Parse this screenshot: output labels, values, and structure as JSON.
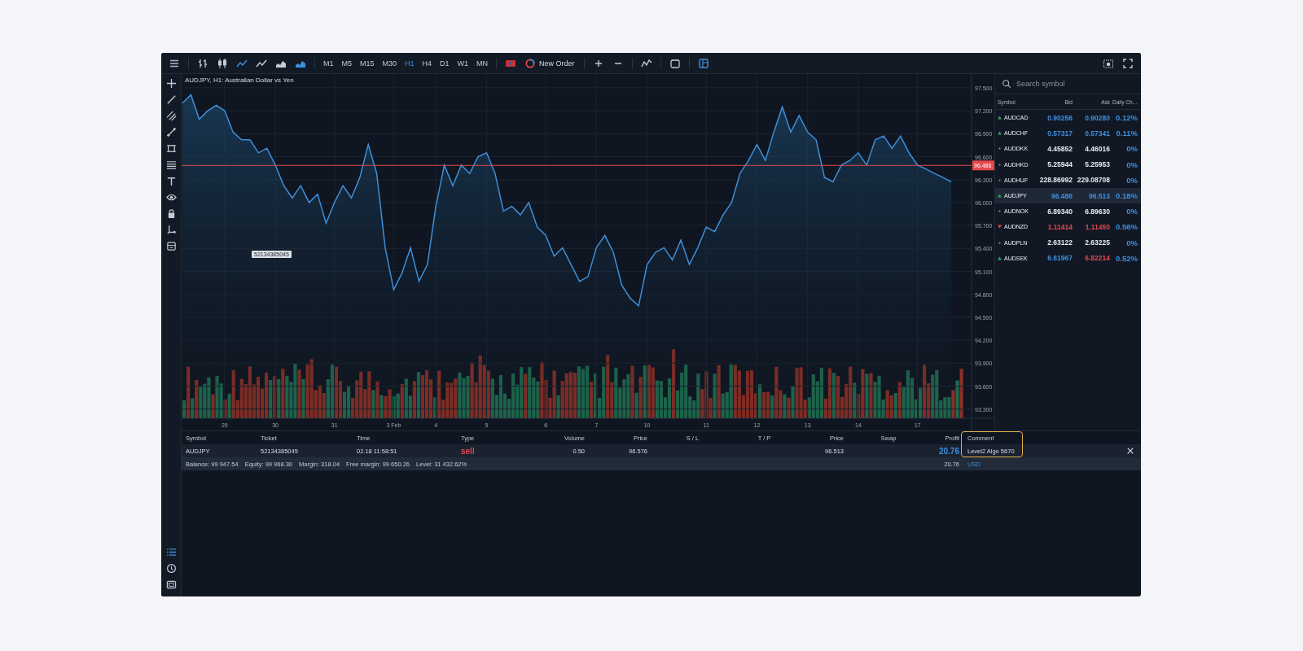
{
  "toolbar": {
    "chart_types": [
      {
        "kind": "bars",
        "selected": false
      },
      {
        "kind": "candles",
        "selected": false
      },
      {
        "kind": "line",
        "selected": true
      },
      {
        "kind": "line",
        "selected": false
      },
      {
        "kind": "area",
        "selected": false
      },
      {
        "kind": "area",
        "selected": true
      }
    ],
    "timeframes": [
      {
        "label": "M1",
        "selected": false
      },
      {
        "label": "M5",
        "selected": false
      },
      {
        "label": "M15",
        "selected": false
      },
      {
        "label": "M30",
        "selected": false
      },
      {
        "label": "H1",
        "selected": true
      },
      {
        "label": "H4",
        "selected": false
      },
      {
        "label": "D1",
        "selected": false
      },
      {
        "label": "W1",
        "selected": false
      },
      {
        "label": "MN",
        "selected": false
      }
    ],
    "new_order": "New Order",
    "layout_active": true
  },
  "chart": {
    "title": "AUDJPY, H1: Australian Dollar vs Yen",
    "order_tag": "52134385045",
    "chart_data": {
      "type": "area",
      "grid": true,
      "ylim": [
        93.18,
        97.68
      ],
      "categories": [
        null,
        null,
        null,
        null,
        null,
        "29",
        null,
        null,
        null,
        null,
        null,
        "30",
        null,
        null,
        null,
        null,
        null,
        null,
        "31",
        null,
        null,
        null,
        null,
        null,
        null,
        "3 Feb",
        null,
        null,
        null,
        null,
        "4",
        null,
        null,
        null,
        null,
        null,
        "5",
        null,
        null,
        null,
        null,
        null,
        null,
        "6",
        null,
        null,
        null,
        null,
        null,
        "7",
        null,
        null,
        null,
        null,
        null,
        "10",
        null,
        null,
        null,
        null,
        null,
        null,
        "11",
        null,
        null,
        null,
        null,
        null,
        "12",
        null,
        null,
        null,
        null,
        null,
        "13",
        null,
        null,
        null,
        null,
        null,
        "14",
        null,
        null,
        null,
        null,
        null,
        null,
        "17",
        null,
        null,
        null,
        null
      ],
      "yticks": [
        {
          "value": 97.5,
          "label": "97.500"
        },
        {
          "value": 97.2,
          "label": "97.200"
        },
        {
          "value": 96.9,
          "label": "96.900"
        },
        {
          "value": 96.6,
          "label": "96.600"
        },
        {
          "value": 96.3,
          "label": "96.300"
        },
        {
          "value": 96.0,
          "label": "96.000"
        },
        {
          "value": 95.7,
          "label": "95.700"
        },
        {
          "value": 95.4,
          "label": "95.400"
        },
        {
          "value": 95.1,
          "label": "95.100"
        },
        {
          "value": 94.8,
          "label": "94.800"
        },
        {
          "value": 94.5,
          "label": "94.500"
        },
        {
          "value": 94.2,
          "label": "94.200"
        },
        {
          "value": 93.9,
          "label": "93.900"
        },
        {
          "value": 93.6,
          "label": "93.600"
        },
        {
          "value": 93.3,
          "label": "93.300"
        }
      ],
      "series": [
        {
          "color": "#3e8ed8",
          "values": [
            97.3,
            97.41,
            97.09,
            97.2,
            97.27,
            97.2,
            96.92,
            96.82,
            96.82,
            96.65,
            96.71,
            96.49,
            96.22,
            96.06,
            96.22,
            96.0,
            96.11,
            95.73,
            96.0,
            96.22,
            96.06,
            96.33,
            96.76,
            96.38,
            95.41,
            94.86,
            95.08,
            95.41,
            94.97,
            95.19,
            95.95,
            96.49,
            96.22,
            96.49,
            96.38,
            96.6,
            96.65,
            96.38,
            95.89,
            95.95,
            95.84,
            96.0,
            95.68,
            95.57,
            95.3,
            95.41,
            95.19,
            94.97,
            95.03,
            95.41,
            95.57,
            95.35,
            94.92,
            94.75,
            94.65,
            95.19,
            95.35,
            95.41,
            95.25,
            95.51,
            95.19,
            95.41,
            95.68,
            95.62,
            95.84,
            96.0,
            96.38,
            96.55,
            96.76,
            96.55,
            96.92,
            97.25,
            96.92,
            97.14,
            96.92,
            96.82,
            96.33,
            96.27,
            96.49,
            96.55,
            96.65,
            96.49,
            96.82,
            96.87,
            96.71,
            96.87,
            96.65,
            96.49,
            96.44,
            96.38,
            96.33,
            96.27
          ]
        }
      ],
      "ref_lines": [
        {
          "axis": "y",
          "value": 96.486,
          "label": "96.486",
          "color": "#e5484d"
        }
      ]
    }
  },
  "market_watch": {
    "search_placeholder": "Search symbol",
    "columns": [
      "Symbol",
      "Bid",
      "Ask",
      "Daily Ch…"
    ],
    "rows": [
      {
        "symbol": "AUDCAD",
        "bid": {
          "text": "0.90256",
          "color": "#3d8fe0"
        },
        "ask": {
          "text": "0.90280",
          "color": "#3d8fe0"
        },
        "change": {
          "text": "0.12%",
          "color": "#3d8fe0"
        },
        "kind": "up",
        "selected": false
      },
      {
        "symbol": "AUDCHF",
        "bid": {
          "text": "0.57317",
          "color": "#3d8fe0"
        },
        "ask": {
          "text": "0.57341",
          "color": "#3d8fe0"
        },
        "change": {
          "text": "0.11%",
          "color": "#3d8fe0"
        },
        "kind": "up",
        "selected": false
      },
      {
        "symbol": "AUDDKK",
        "bid": {
          "text": "4.45852",
          "color": "#e6eaf0"
        },
        "ask": {
          "text": "4.46016",
          "color": "#e6eaf0"
        },
        "change": {
          "text": "0%",
          "color": "#3d8fe0"
        },
        "kind": "flat",
        "selected": false
      },
      {
        "symbol": "AUDHKD",
        "bid": {
          "text": "5.25944",
          "color": "#e6eaf0"
        },
        "ask": {
          "text": "5.25953",
          "color": "#e6eaf0"
        },
        "change": {
          "text": "0%",
          "color": "#3d8fe0"
        },
        "kind": "flat",
        "selected": false
      },
      {
        "symbol": "AUDHUF",
        "bid": {
          "text": "228.86992",
          "color": "#e6eaf0"
        },
        "ask": {
          "text": "229.08708",
          "color": "#e6eaf0"
        },
        "change": {
          "text": "0%",
          "color": "#3d8fe0"
        },
        "kind": "flat",
        "selected": false
      },
      {
        "symbol": "AUDJPY",
        "bid": {
          "text": "96.486",
          "color": "#3d8fe0"
        },
        "ask": {
          "text": "96.513",
          "color": "#3d8fe0"
        },
        "change": {
          "text": "0.18%",
          "color": "#3d8fe0"
        },
        "kind": "up",
        "selected": true
      },
      {
        "symbol": "AUDNOK",
        "bid": {
          "text": "6.89340",
          "color": "#e6eaf0"
        },
        "ask": {
          "text": "6.89630",
          "color": "#e6eaf0"
        },
        "change": {
          "text": "0%",
          "color": "#3d8fe0"
        },
        "kind": "flat",
        "selected": false
      },
      {
        "symbol": "AUDNZD",
        "bid": {
          "text": "1.11414",
          "color": "#e5484d"
        },
        "ask": {
          "text": "1.11450",
          "color": "#e5484d"
        },
        "change": {
          "text": "0.56%",
          "color": "#3d8fe0"
        },
        "kind": "down",
        "selected": false
      },
      {
        "symbol": "AUDPLN",
        "bid": {
          "text": "2.63122",
          "color": "#e6eaf0"
        },
        "ask": {
          "text": "2.63225",
          "color": "#e6eaf0"
        },
        "change": {
          "text": "0%",
          "color": "#3d8fe0"
        },
        "kind": "flat",
        "selected": false
      },
      {
        "symbol": "AUDSEK",
        "bid": {
          "text": "6.81967",
          "color": "#3d8fe0"
        },
        "ask": {
          "text": "6.82214",
          "color": "#e5484d"
        },
        "change": {
          "text": "0.52%",
          "color": "#3d8fe0"
        },
        "kind": "up",
        "selected": false
      }
    ]
  },
  "positions": {
    "columns": [
      {
        "label": "Symbol",
        "highlighted": false
      },
      {
        "label": "Ticket",
        "highlighted": false
      },
      {
        "label": "Time",
        "highlighted": false
      },
      {
        "label": "Type",
        "highlighted": false
      },
      {
        "label": "Volume",
        "highlighted": false
      },
      {
        "label": "Price",
        "highlighted": false
      },
      {
        "label": "S / L",
        "highlighted": false
      },
      {
        "label": "T / P",
        "highlighted": false
      },
      {
        "label": "Price",
        "highlighted": false
      },
      {
        "label": "Swap",
        "highlighted": false
      },
      {
        "label": "Profit",
        "highlighted": false
      },
      {
        "label": "Comment",
        "highlighted": true
      }
    ],
    "rows": [
      {
        "cells": [
          "AUDJPY",
          "52134385045",
          "02.18 11:58:51",
          {
            "text": "sell",
            "color": "#e5484d"
          },
          "0.50",
          "96.576",
          null,
          null,
          "96.513",
          null,
          {
            "text": "20.76",
            "color": "#3d8fe0"
          },
          "Level2 Algo 5670"
        ]
      }
    ],
    "summary": [
      "Balance: 99 947.54",
      "Equity: 99 968.30",
      "Margin: 318.04",
      "Free margin: 99 650.26",
      "Level: 31 432.62%"
    ],
    "total_profit": "20.76",
    "currency": "USD"
  }
}
